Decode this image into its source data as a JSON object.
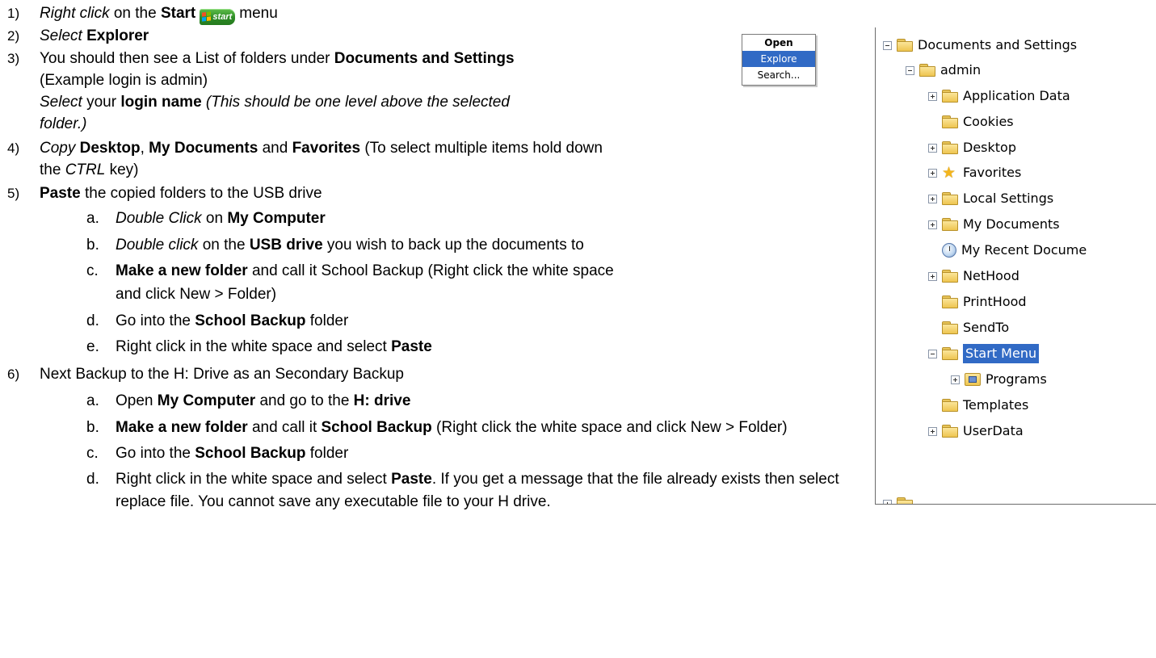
{
  "steps": {
    "s1": {
      "num": "1)",
      "a": "Right click",
      "b": " on the ",
      "c": "Start",
      "d": "menu",
      "start_btn": "start"
    },
    "s2": {
      "num": "2)",
      "a": "Select",
      "b": " ",
      "c": "Explorer"
    },
    "s3": {
      "num": "3)",
      "a": "You should then see a List of folders under ",
      "b": "Documents and Settings",
      "line2": "(Example login is admin)",
      "c": "Select",
      "d": " your ",
      "e": "login name",
      "f": " ",
      "g": "(This should be one level above the selected",
      "line4": "folder.)"
    },
    "s4": {
      "num": "4)",
      "a": "Copy",
      "b": " ",
      "c": "Desktop",
      "d": ", ",
      "e": "My Documents",
      "f": " and ",
      "g": "Favorites",
      "h": " (To select multiple items hold down",
      "line2a": "the ",
      "line2b": "CTRL",
      "line2c": " key)"
    },
    "s5": {
      "num": "5)",
      "a": "Paste",
      "b": " the copied folders to the USB drive",
      "a_": {
        "letter": "a.",
        "a": "Double Click",
        "b": " on ",
        "c": "My Computer"
      },
      "b_": {
        "letter": "b.",
        "a": "Double click",
        "b": " on the ",
        "c": "USB drive",
        "d": " you wish to back up the documents to"
      },
      "c_": {
        "letter": "c.",
        "a": "Make a new folder",
        "b": " and call it School Backup (Right click the white space",
        "line2": "and click New > Folder)"
      },
      "d_": {
        "letter": "d.",
        "a": "Go into the ",
        "b": "School Backup",
        "c": " folder"
      },
      "e_": {
        "letter": "e.",
        "a": "Right click in the white space and select ",
        "b": "Paste"
      }
    },
    "s6": {
      "num": "6)",
      "a": "Next Backup to the H: Drive as an Secondary Backup",
      "a_": {
        "letter": "a.",
        "a": "Open ",
        "b": "My Computer",
        "c": " and go to the ",
        "d": "H: drive"
      },
      "b_": {
        "letter": "b.",
        "a": "Make a new folder",
        "b": " and call it ",
        "c": "School Backup",
        "d": " (Right click the white space and click New > Folder)"
      },
      "c_": {
        "letter": "c.",
        "a": "Go into the ",
        "b": "School Backup",
        "c": " folder"
      },
      "d_": {
        "letter": "d.",
        "a": "Right click in the white space and select ",
        "b": "Paste",
        "c": ".  If you get a message that the file already exists then select",
        "line2": "replace file. You cannot save any executable file to your H drive."
      }
    }
  },
  "context_menu": {
    "open": "Open",
    "explore": "Explore",
    "search": "Search..."
  },
  "tree": [
    {
      "label": "Documents and Settings"
    },
    {
      "label": "admin"
    },
    {
      "label": "Application Data"
    },
    {
      "label": "Cookies"
    },
    {
      "label": "Desktop"
    },
    {
      "label": "Favorites"
    },
    {
      "label": "Local Settings"
    },
    {
      "label": "My Documents"
    },
    {
      "label": "My Recent Docume"
    },
    {
      "label": "NetHood"
    },
    {
      "label": "PrintHood"
    },
    {
      "label": "SendTo"
    },
    {
      "label": "Start Menu"
    },
    {
      "label": "Programs"
    },
    {
      "label": "Templates"
    },
    {
      "label": "UserData"
    }
  ],
  "colors": {
    "selection": "#316ac5",
    "start_green": "#2e8b26",
    "folder_yellow": "#eec550"
  }
}
